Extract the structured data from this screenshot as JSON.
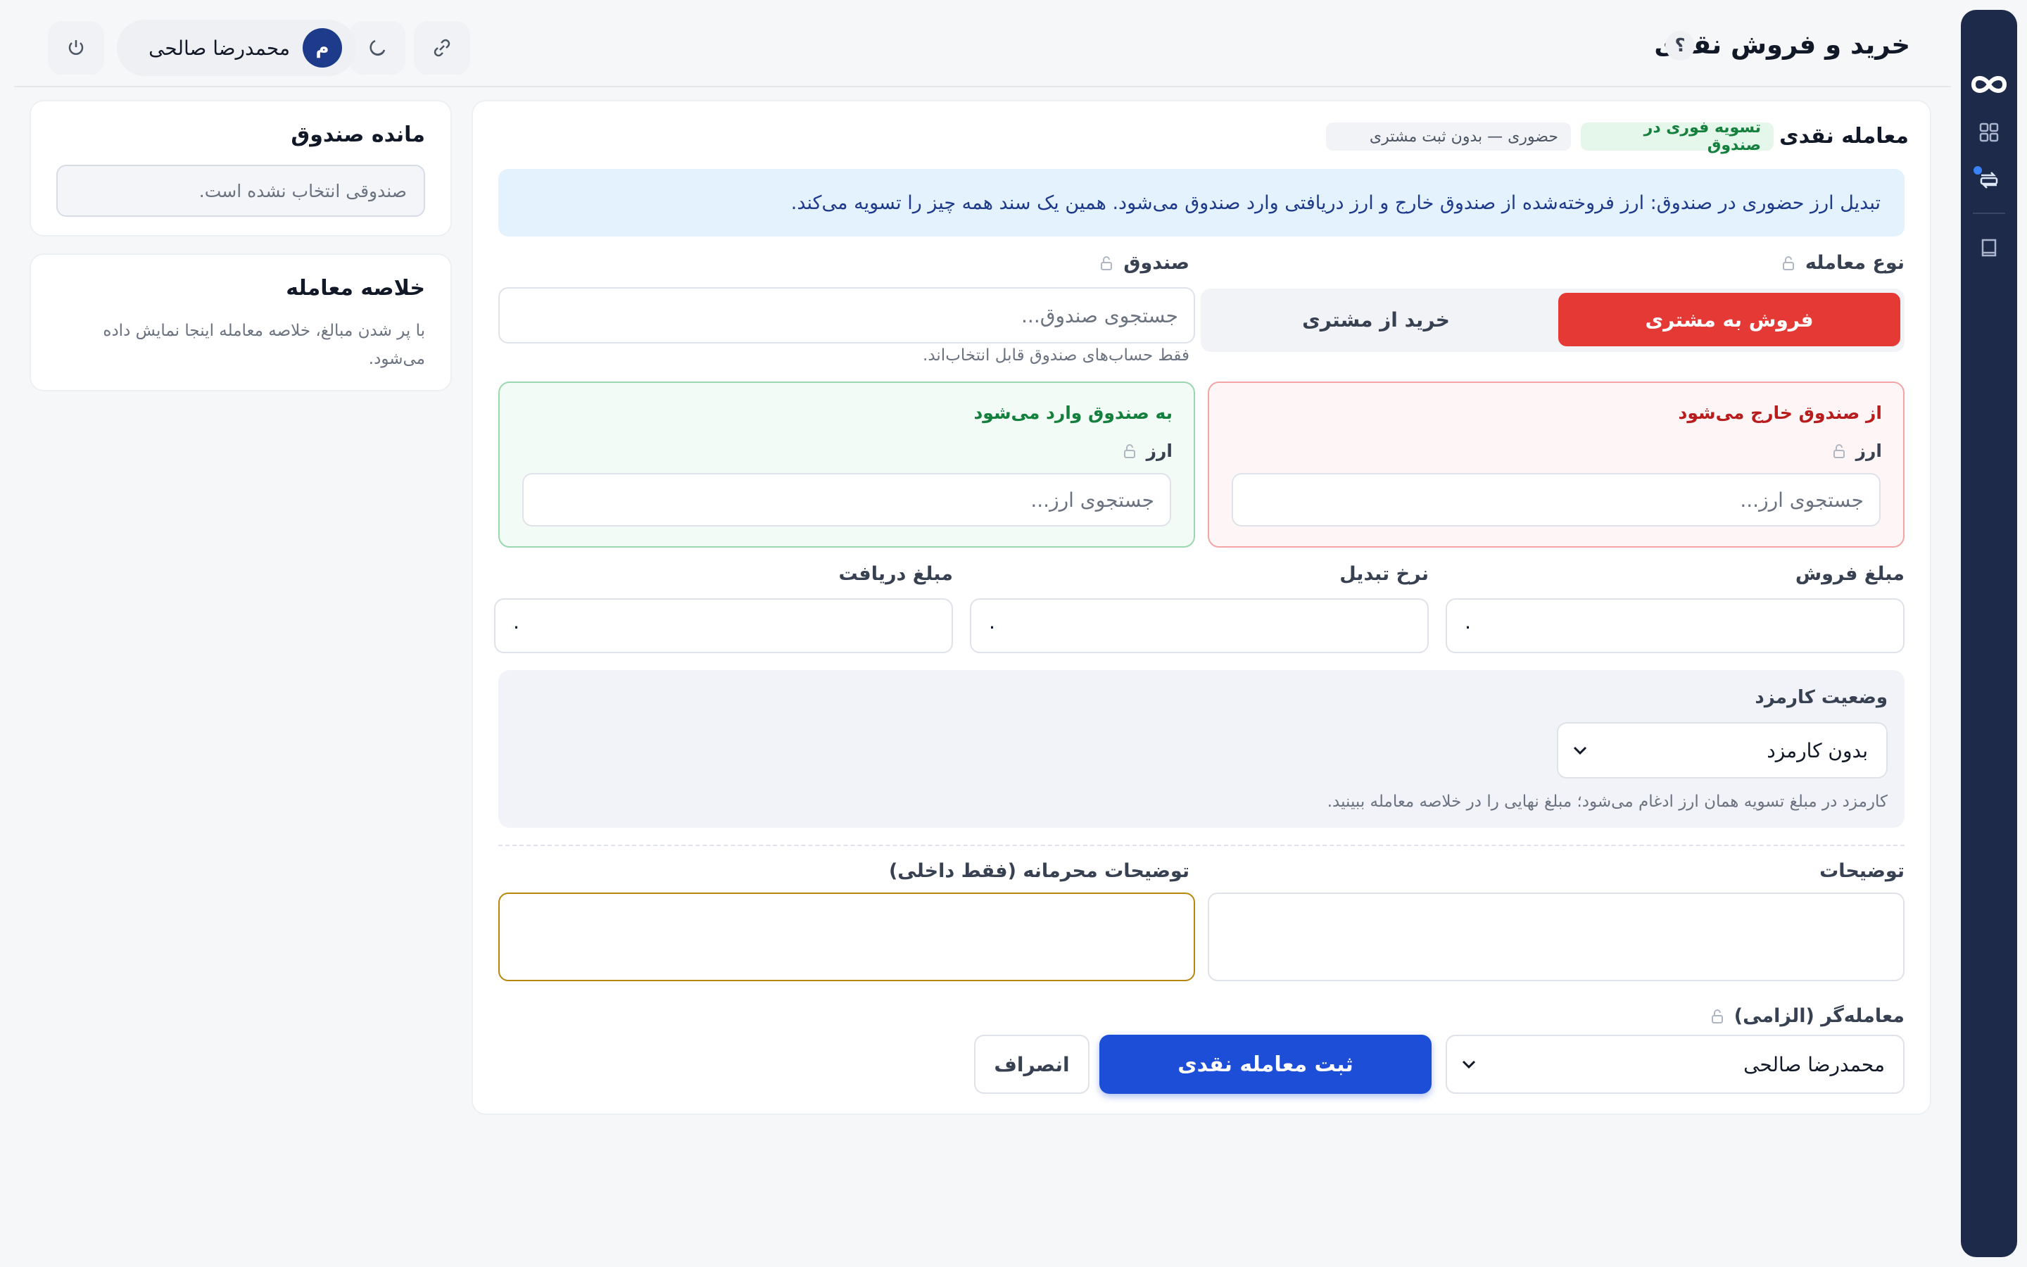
{
  "header": {
    "title": "خرید و فروش نقدی",
    "help_label": "؟",
    "user_name": "محمدرضا صالحی",
    "user_initial": "م"
  },
  "rail": {
    "items": [
      "dashboard-icon",
      "exchange-icon",
      "book-icon"
    ]
  },
  "side": {
    "fund_balance_title": "مانده صندوق",
    "fund_balance_empty": "صندوقی انتخاب نشده است.",
    "summary_title": "خلاصه معامله",
    "summary_text": "با پر شدن مبالغ، خلاصه معامله اینجا نمایش داده می‌شود."
  },
  "main": {
    "title": "معامله نقدی",
    "badge_settle": "تسویه فوری در صندوق",
    "badge_mode": "حضوری — بدون ثبت مشتری",
    "info": "تبدیل ارز حضوری در صندوق: ارز فروخته‌شده از صندوق خارج و ارز دریافتی وارد صندوق می‌شود. همین یک سند همه چیز را تسویه می‌کند.",
    "trade_type_label": "نوع معامله",
    "trade_type_sell": "فروش به مشتری",
    "trade_type_buy": "خرید از مشتری",
    "fund_label": "صندوق",
    "fund_placeholder": "جستجوی صندوق...",
    "fund_hint": "فقط حساب‌های صندوق قابل انتخاب‌اند.",
    "out_title": "از صندوق خارج می‌شود",
    "in_title": "به صندوق وارد می‌شود",
    "currency_label": "ارز",
    "currency_placeholder": "جستجوی ارز...",
    "sell_amount_label": "مبلغ فروش",
    "rate_label": "نرخ تبدیل",
    "receive_amount_label": "مبلغ دریافت",
    "sell_amount_value": "۰",
    "rate_value": "۰",
    "receive_amount_value": "۰",
    "fee_label": "وضعیت کارمزد",
    "fee_value": "بدون کارمزد",
    "fee_hint": "کارمزد در مبلغ تسویه همان ارز ادغام می‌شود؛ مبلغ نهایی را در خلاصه معامله ببینید.",
    "notes_label": "توضیحات",
    "private_notes_label": "توضیحات محرمانه (فقط داخلی)",
    "trader_label": "معامله‌گر (الزامی)",
    "trader_value": "محمدرضا صالحی",
    "submit_label": "ثبت معامله نقدی",
    "cancel_label": "انصراف"
  },
  "colors": {
    "sell_active": "#e53935",
    "primary": "#1d4ed8",
    "rail": "#1e2a4a",
    "out_border": "#f3a5a5",
    "in_border": "#9ad8b0"
  }
}
